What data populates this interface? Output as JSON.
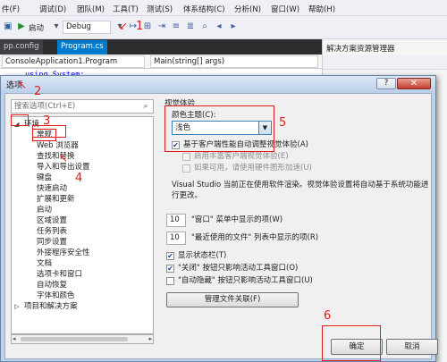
{
  "ide": {
    "menus": [
      "件(F)",
      "调试(D)",
      "团队(M)",
      "工具(T)",
      "测试(S)",
      "体系结构(C)",
      "分析(N)",
      "窗口(W)",
      "帮助(H)"
    ],
    "start_label": "启动",
    "config_combo": "Debug",
    "tabs": [
      "pp.config",
      "Program.cs"
    ],
    "nav_left": "ConsoleApplication1.Program",
    "nav_right": "Main(string[] args)",
    "code_line": "using System;",
    "solution_title": "解决方案资源管理器"
  },
  "dialog": {
    "title": "选项",
    "help_label": "?",
    "close_label": "✕",
    "search_placeholder": "搜索选项(Ctrl+E)",
    "tree": [
      {
        "label": "环境",
        "level": 0,
        "expanded": true
      },
      {
        "label": "常规",
        "level": 1,
        "selected": true
      },
      {
        "label": "Web 浏览器",
        "level": 1
      },
      {
        "label": "查找和替换",
        "level": 1
      },
      {
        "label": "导入和导出设置",
        "level": 1
      },
      {
        "label": "键盘",
        "level": 1
      },
      {
        "label": "快速启动",
        "level": 1
      },
      {
        "label": "扩展和更新",
        "level": 1
      },
      {
        "label": "启动",
        "level": 1
      },
      {
        "label": "区域设置",
        "level": 1
      },
      {
        "label": "任务列表",
        "level": 1
      },
      {
        "label": "同步设置",
        "level": 1
      },
      {
        "label": "外接程序安全性",
        "level": 1
      },
      {
        "label": "文档",
        "level": 1
      },
      {
        "label": "选项卡和窗口",
        "level": 1
      },
      {
        "label": "自动恢复",
        "level": 1
      },
      {
        "label": "字体和颜色",
        "level": 1
      },
      {
        "label": "项目和解决方案",
        "level": 0,
        "expanded": false
      }
    ],
    "visual_section_title": "视觉体验",
    "theme_label": "颜色主题(C):",
    "theme_value": "浅色",
    "auto_adjust_label": "基于客户端性能自动调整视觉体验(A)",
    "rich_client_label": "启用丰富客户端视觉体验(E)",
    "hw_accel_label": "如果可用，请使用硬件图形加速(U)",
    "info_text": "Visual Studio 当前正在使用软件渲染。视觉体验设置将自动基于系统功能进行更改。",
    "window_menu_count": "10",
    "window_menu_label": "\"窗口\" 菜单中显示的项(W)",
    "recent_files_count": "10",
    "recent_files_label": "\"最近使用的文件\" 列表中显示的项(R)",
    "status_bar_label": "显示状态栏(T)",
    "close_affects_label": "\"关闭\" 按钮只影响活动工具窗口(O)",
    "autohide_affects_label": "\"自动隐藏\" 按钮只影响活动工具窗口(U)",
    "file_assoc_label": "管理文件关联(F)",
    "ok_label": "确定",
    "cancel_label": "取消"
  },
  "annotations": [
    "1",
    "2",
    "3",
    "4",
    "5",
    "6"
  ],
  "colors": {
    "annotation": "#e21b1b",
    "accent": "#007acc"
  }
}
